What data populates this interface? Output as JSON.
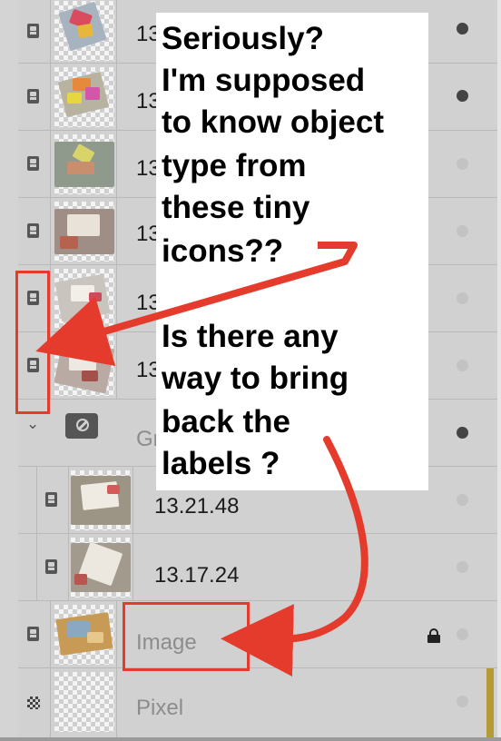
{
  "layers": [
    {
      "kind": "object",
      "name": "13.",
      "visible": true
    },
    {
      "kind": "object",
      "name": "13",
      "visible": true
    },
    {
      "kind": "object",
      "name": "13",
      "visible": false
    },
    {
      "kind": "object",
      "name": "13",
      "visible": false
    },
    {
      "kind": "object",
      "name": "13",
      "visible": false
    },
    {
      "kind": "object",
      "name": "13",
      "visible": false
    },
    {
      "kind": "group",
      "name": "Gr",
      "visible": true,
      "expanded": true
    },
    {
      "kind": "object",
      "name": "13.21.48",
      "visible": false,
      "child": true
    },
    {
      "kind": "object",
      "name": "13.17.24",
      "visible": false,
      "child": true
    },
    {
      "kind": "image",
      "name": "Image",
      "visible": false,
      "locked": true
    },
    {
      "kind": "pixel",
      "name": "Pixel",
      "visible": false
    }
  ],
  "icons": {
    "object": "object-layer-icon",
    "pixel": "pixel-layer-icon",
    "group": "group-clip-icon",
    "expand": "chevron-down-icon",
    "lock": "lock-icon",
    "visibility": "visibility-dot-icon"
  },
  "callout": {
    "lines": [
      "Seriously?",
      "I'm supposed",
      "to know object",
      "type from",
      "these tiny",
      "icons??",
      "",
      "Is there any",
      "way to bring",
      "back the",
      "labels ?"
    ]
  },
  "colors": {
    "annotation_red": "#e53b2c",
    "panel_bg": "#d1d1d1",
    "row_divider": "#b9b9b9",
    "accent_bar": "#b49b36"
  }
}
